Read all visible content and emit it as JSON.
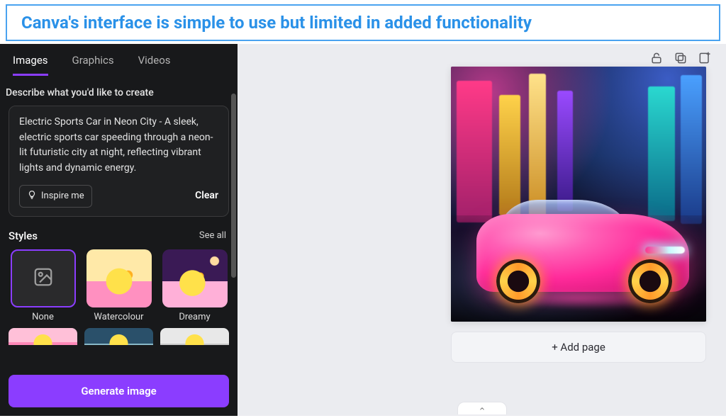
{
  "caption": "Canva's interface is simple to use but limited in added functionality",
  "sidebar": {
    "tabs": {
      "images": "Images",
      "graphics": "Graphics",
      "videos": "Videos"
    },
    "describe_label": "Describe what you'd like to create",
    "prompt_text": "Electric Sports Car in Neon City - A sleek, electric sports car speeding through a neon-lit futuristic city at night, reflecting vibrant lights and dynamic energy.",
    "inspire_label": "Inspire me",
    "clear_label": "Clear",
    "styles_title": "Styles",
    "see_all": "See all",
    "styles": {
      "none": "None",
      "watercolour": "Watercolour",
      "dreamy": "Dreamy"
    },
    "generate_label": "Generate image"
  },
  "canvas": {
    "add_page_label": "+ Add page",
    "image_description": "Pink futuristic electric sports car on a wet street in a neon-lit city at night with glowing orange wheels and cyan headlight"
  },
  "colors": {
    "accent": "#8b3dff",
    "caption_blue": "#2a91e8"
  }
}
